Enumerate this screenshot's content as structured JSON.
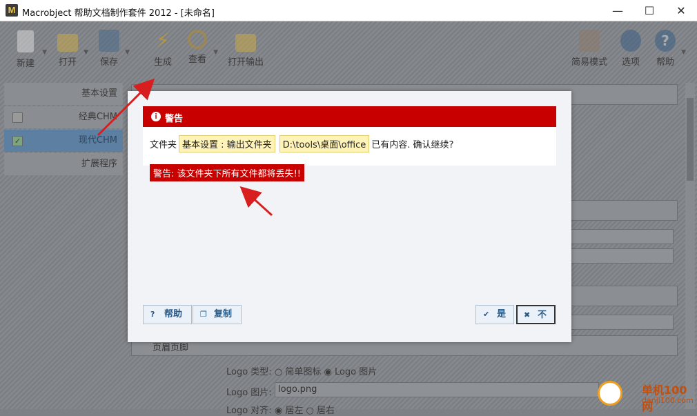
{
  "window": {
    "title": "Macrobject 帮助文档制作套件 2012 - [未命名]",
    "app_icon": "M",
    "minimize_glyph": "—",
    "maximize_glyph": "☐",
    "close_glyph": "✕"
  },
  "toolbar": {
    "new": "新建",
    "open": "打开",
    "save": "保存",
    "generate": "生成",
    "view": "查看",
    "open_output": "打开输出",
    "easy_mode": "简易模式",
    "options": "选项",
    "help": "帮助"
  },
  "sidebar": {
    "items": [
      {
        "label": "基本设置",
        "checked": ""
      },
      {
        "label": "经典CHM",
        "checked": ""
      },
      {
        "label": "现代CHM",
        "checked": "✓"
      },
      {
        "label": "扩展程序",
        "checked": ""
      }
    ]
  },
  "background": {
    "section_header_footer": "页眉页脚",
    "logo_type_label": "Logo 类型:",
    "logo_type_option1": "简单图标",
    "logo_type_option2": "Logo 图片",
    "logo_image_label": "Logo 图片:",
    "logo_image_value": "logo.png",
    "logo_align_label": "Logo 对齐:",
    "logo_align_option1": "居左",
    "logo_align_option2": "居右"
  },
  "dialog": {
    "title": "警告",
    "message_prefix": "文件夹",
    "setting_tag": "基本设置 : 输出文件夹",
    "path_tag": "D:\\tools\\桌面\\office",
    "message_suffix": "已有内容. 确认继续?",
    "warning": "警告: 该文件夹下所有文件都将丢失!!",
    "help_button": "帮助",
    "copy_button": "复制",
    "yes_button": "是",
    "no_button": "不"
  },
  "watermark": {
    "line1": "单机100网",
    "line2": "danji100.com"
  },
  "colors": {
    "dialog_header": "#c80000",
    "tag_background": "#fff3b8",
    "annotation_arrow": "#d81e1e"
  }
}
